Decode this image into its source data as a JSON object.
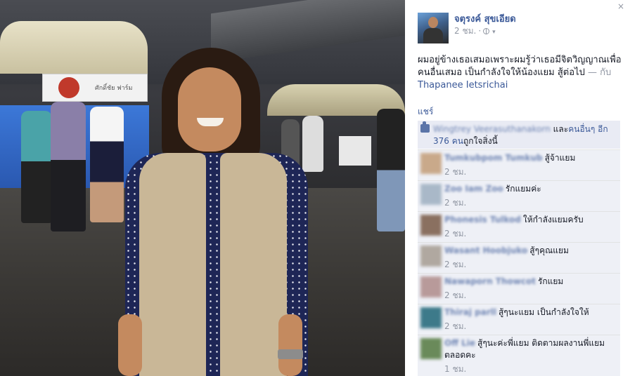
{
  "photo": {
    "sign_text": "ศักดิ์ชัย ฟาร์ม"
  },
  "panel": {
    "close_label": "×",
    "author": {
      "name": "จตุรงค์ สุขเอียด",
      "time": "2 ชม.",
      "sep": "·"
    },
    "post": {
      "text": "ผมอยู่ข้างเธอเสมอเพราะผมรู้ว่าเธอมีจิตวิญญาณเพื่อคนอื่นเสมอ เป็นกำลังใจให้น้องแยม สู้ต่อไป",
      "with_label": "— กับ",
      "tagged": "Thapanee Ietsrichai"
    },
    "share_label": "แชร์",
    "likes": {
      "first_name": "Wingtrey Veerasuthanakorn",
      "and_label": "และ",
      "others_link": "คนอื่นๆ อีก 376 คน",
      "suffix": "ถูกใจสิ่งนี้"
    },
    "comments": [
      {
        "name": "Tumkubpom Tumkub",
        "text": "สู้จ้าแยม",
        "time": "2 ชม.",
        "color": "#c9a98a"
      },
      {
        "name": "Zoo Iam Zoo",
        "text": "รักแยมค่ะ",
        "time": "2 ชม.",
        "color": "#a9b8c8"
      },
      {
        "name": "Phonesis Tulkod",
        "text": "ให้กำลังแยมครับ",
        "time": "2 ชม.",
        "color": "#8a7060"
      },
      {
        "name": "Wasant Hoobjuko",
        "text": "สู้ๆคุณแยม",
        "time": "2 ชม.",
        "color": "#b0a8a0"
      },
      {
        "name": "Nawaporn Thowcot",
        "text": "รักแยม",
        "time": "2 ชม.",
        "color": "#b89a9a"
      },
      {
        "name": "Thiraj parll",
        "text": "สู้ๆนะแยม เป็นกำลังใจให้",
        "time": "2 ชม.",
        "color": "#3d7a8a"
      },
      {
        "name": "Off Lie",
        "text": "สู้ๆนะค่ะพี่แยม ติดตามผลงานพี่แยมตลอดคะ",
        "time": "1 ชม.",
        "color": "#6a8a5a"
      }
    ]
  }
}
